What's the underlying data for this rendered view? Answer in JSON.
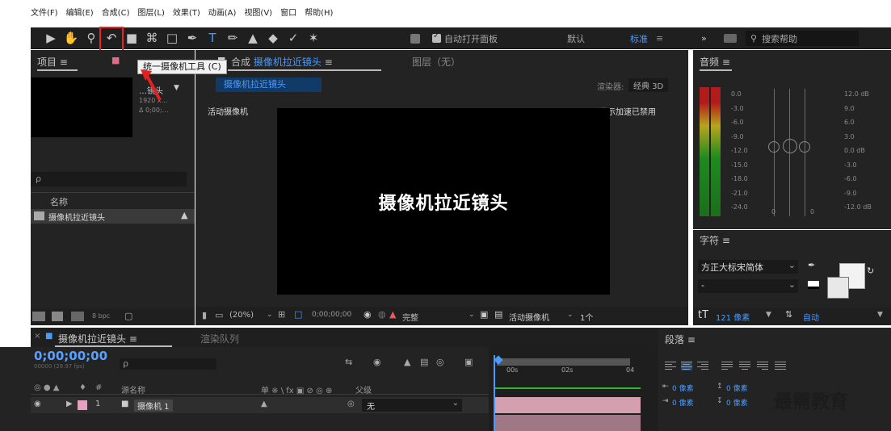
{
  "menubar": [
    "文件(F)",
    "编辑(E)",
    "合成(C)",
    "图层(L)",
    "效果(T)",
    "动画(A)",
    "视图(V)",
    "窗口",
    "帮助(H)"
  ],
  "toolbar": {
    "icons": [
      "selection-arrow-icon",
      "hand-icon",
      "zoom-icon",
      "rotate-icon",
      "camera-icon",
      "pan-behind-icon",
      "rectangle-icon",
      "pen-icon",
      "type-icon",
      "brush-icon",
      "clone-stamp-icon",
      "eraser-icon",
      "roto-brush-icon",
      "puppet-pin-icon"
    ],
    "auto_open_label": "自动打开面板",
    "default_label": "默认",
    "standard_label": "标准",
    "search_help_placeholder": "搜索帮助"
  },
  "tooltip": "统一摄像机工具 (C)",
  "project": {
    "title": "项目",
    "comp_name_short": "…镜头",
    "comp_size": "1920 x…",
    "comp_duration": "Δ 0;00;…",
    "search_icon_label": "ρ",
    "name_header": "名称",
    "item_name": "摄像机拉近镜头",
    "bpc": "8 bpc"
  },
  "composition": {
    "panel_prefix": "合成",
    "panel_name": "摄像机拉近镜头",
    "layer_panel": "图层（无）",
    "tab_label": "摄像机拉近镜头",
    "renderer_label": "渲染器:",
    "renderer_value": "经典 3D",
    "active_camera": "活动摄像机",
    "accel_disabled": "显示加速已禁用",
    "viewer_text": "摄像机拉近镜头",
    "zoom": "(20%)",
    "timecode": "0;00;00;00",
    "resolution": "完整",
    "view": "活动摄像机",
    "views_count": "1个"
  },
  "audio": {
    "title": "音频",
    "left_scale": [
      "0.0",
      "-3.0",
      "-6.0",
      "-9.0",
      "-12.0",
      "-15.0",
      "-18.0",
      "-21.0",
      "-24.0"
    ],
    "right_scale": [
      "12.0 dB",
      "9.0",
      "6.0",
      "3.0",
      "0.0 dB",
      "-3.0",
      "-6.0",
      "-9.0",
      "-12.0 dB"
    ],
    "marker_left": "0",
    "marker_right": "0"
  },
  "character": {
    "title": "字符",
    "font": "方正大标宋简体",
    "style": "-",
    "size_label": "121 像素",
    "leading_label": "自动"
  },
  "paragraph": {
    "title": "段落",
    "indent_values": [
      "0 像素",
      "0 像素",
      "0 像素",
      "0 像素"
    ]
  },
  "timeline": {
    "comp_name": "摄像机拉近镜头",
    "render_queue": "渲染队列",
    "timecode": "0;00;00;00",
    "fps_line": "00000 (29.97 fps)",
    "search_icon_label": "ρ",
    "col_hash": "#",
    "col_source": "源名称",
    "col_switches": "单 ※ \\ fx ▣ ⊘ ◎ ⊕",
    "col_parent": "父级",
    "row_number": "1",
    "row_name": "摄像机 1",
    "parent_value": "无",
    "ruler": [
      "00s",
      "02s",
      "04"
    ]
  },
  "watermark": "最需教育",
  "colors": {
    "accent": "#4a9bff",
    "highlight": "#e22222",
    "timecode": "#5aa0ff",
    "layer_bar": "#d4a0b0"
  }
}
